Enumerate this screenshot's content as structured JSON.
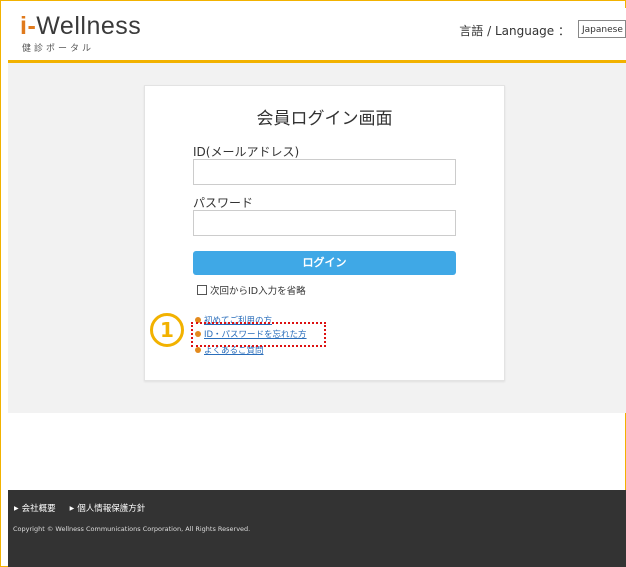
{
  "header": {
    "logo_i": "i",
    "logo_dash": "-",
    "logo_text": "Wellness",
    "logo_sub": "健診ポータル",
    "language_label": "言語 / Language ：",
    "language_selected": "Japanese"
  },
  "login": {
    "title": "会員ログイン画面",
    "id_label": "ID(メールアドレス)",
    "id_value": "",
    "password_label": "パスワード",
    "password_value": "",
    "login_button": "ログイン",
    "remember_label": "次回からID入力を省略",
    "links": [
      {
        "label": "初めてご利用の方"
      },
      {
        "label": "ID・パスワードを忘れた方"
      },
      {
        "label": "よくあるご質問"
      }
    ]
  },
  "annotation": {
    "badge_number": "1",
    "badge_color": "#f2b200",
    "highlight_color": "#dd1111"
  },
  "footer": {
    "nav": [
      {
        "label": "会社概要"
      },
      {
        "label": "個人情報保護方針"
      }
    ],
    "copyright": "Copyright © Wellness Communications Corporation, All Rights Reserved."
  },
  "colors": {
    "accent": "#f2b200",
    "button": "#3fa8e6",
    "link": "#2a6ebb",
    "footer_bg": "#333333"
  }
}
